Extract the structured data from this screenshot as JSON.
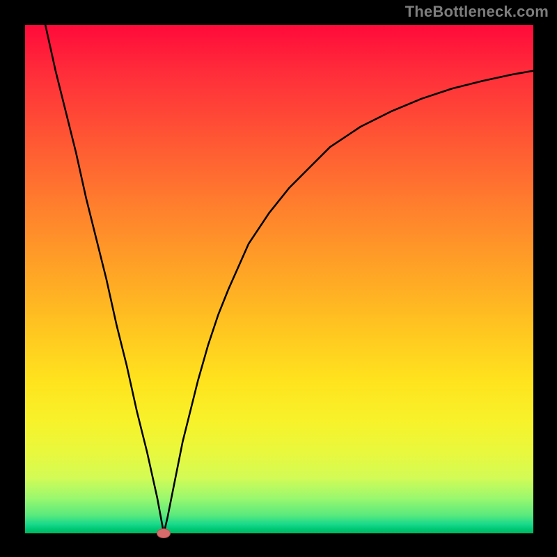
{
  "watermark": "TheBottleneck.com",
  "chart_data": {
    "type": "line",
    "title": "",
    "xlabel": "",
    "ylabel": "",
    "xlim": [
      0,
      100
    ],
    "ylim": [
      0,
      100
    ],
    "series": [
      {
        "name": "bottleneck-curve",
        "x": [
          4,
          6,
          8,
          10,
          12,
          14,
          16,
          18,
          20,
          22,
          24,
          26,
          27.3,
          28,
          29,
          30,
          31,
          32,
          34,
          36,
          38,
          40,
          44,
          48,
          52,
          56,
          60,
          66,
          72,
          78,
          84,
          90,
          96,
          100
        ],
        "values": [
          100,
          91,
          83,
          75,
          66,
          58,
          50,
          41,
          33,
          24,
          16,
          7,
          0,
          3,
          8,
          13,
          18,
          22,
          30,
          37,
          43,
          48,
          57,
          63,
          68,
          72,
          76,
          80,
          83,
          85.5,
          87.5,
          89,
          90.3,
          91
        ]
      }
    ],
    "marker": {
      "x": 27.3,
      "y": 0,
      "label": "optimal-point"
    },
    "gradient_stops": [
      {
        "pos": 0,
        "color": "#ff0a3a"
      },
      {
        "pos": 0.5,
        "color": "#ffb724"
      },
      {
        "pos": 0.8,
        "color": "#f5f52c"
      },
      {
        "pos": 1.0,
        "color": "#00b85f"
      }
    ]
  }
}
